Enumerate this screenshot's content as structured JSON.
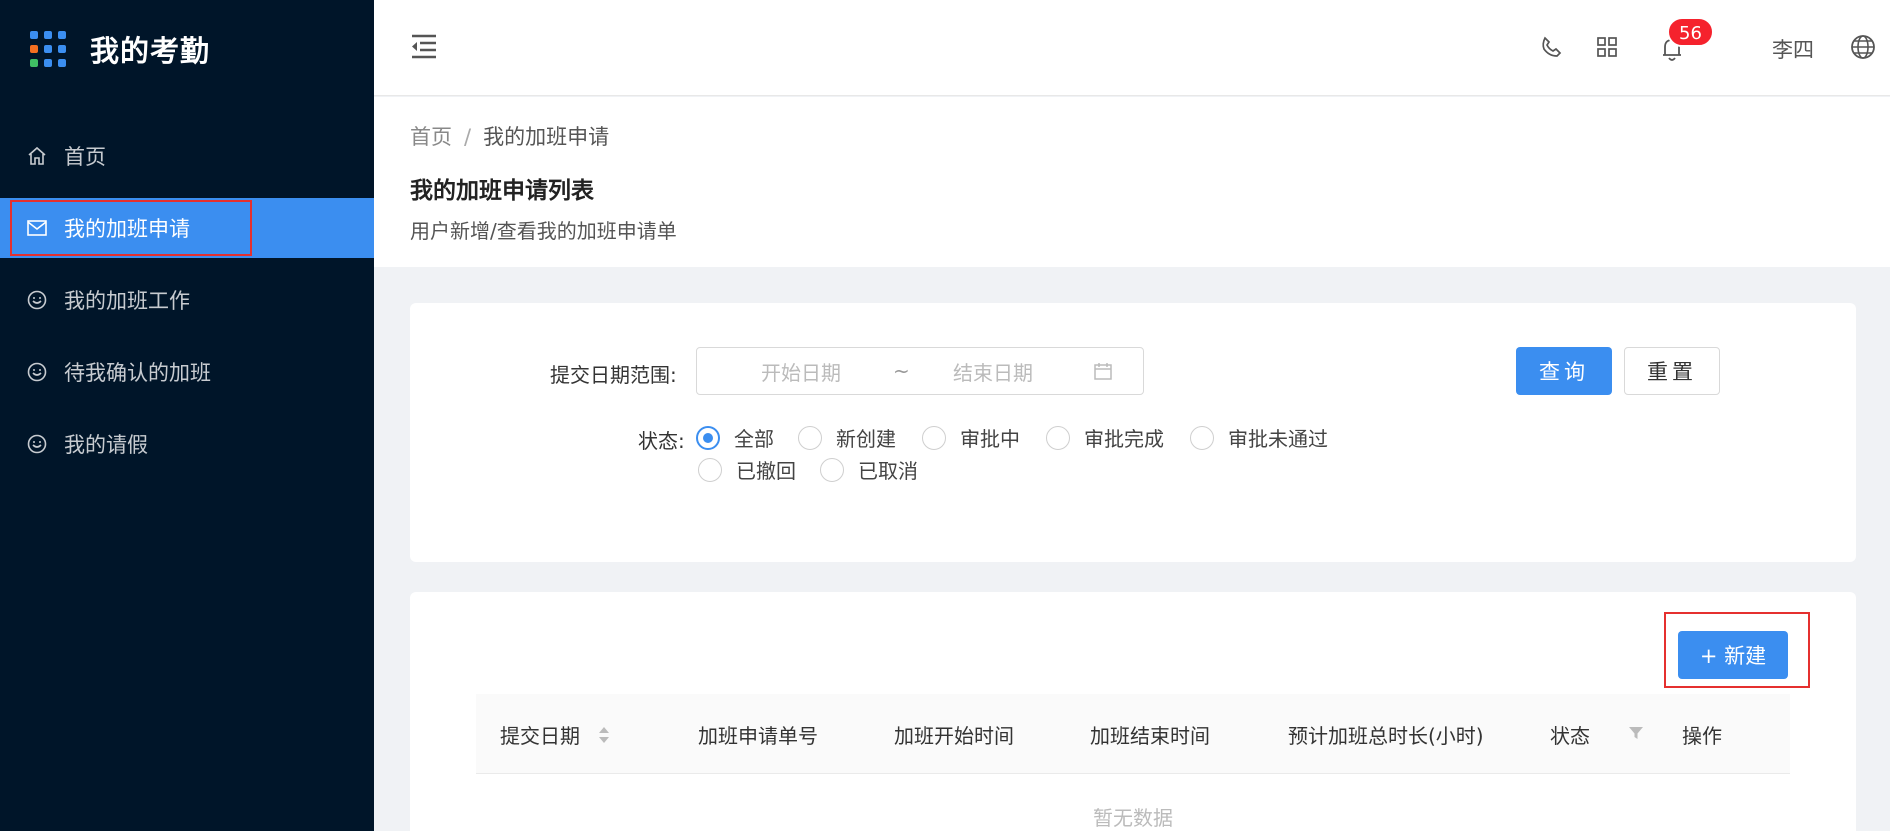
{
  "app": {
    "title": "我的考勤"
  },
  "sidebar": {
    "items": [
      {
        "label": "首页",
        "icon": "home-icon"
      },
      {
        "label": "我的加班申请",
        "icon": "mail-icon",
        "active": true
      },
      {
        "label": "我的加班工作",
        "icon": "smile-icon"
      },
      {
        "label": "待我确认的加班",
        "icon": "smile-icon"
      },
      {
        "label": "我的请假",
        "icon": "smile-icon"
      }
    ]
  },
  "header": {
    "notification_count": "56",
    "user_name": "李四",
    "icons": [
      "menu-fold-icon",
      "phone-icon",
      "apps-icon",
      "bell-icon",
      "globe-icon"
    ]
  },
  "breadcrumb": {
    "home": "首页",
    "separator": "/",
    "current": "我的加班申请"
  },
  "page": {
    "title": "我的加班申请列表",
    "description": "用户新增/查看我的加班申请单"
  },
  "search": {
    "date_label": "提交日期范围:",
    "start_placeholder": "开始日期",
    "range_sep": "~",
    "end_placeholder": "结束日期",
    "query_label": "查询",
    "reset_label": "重置",
    "status_label": "状态:",
    "status_options": [
      "全部",
      "新创建",
      "审批中",
      "审批完成",
      "审批未通过",
      "已撤回",
      "已取消"
    ],
    "status_selected": "全部"
  },
  "table": {
    "new_label": "+ 新建",
    "columns": [
      "提交日期",
      "加班申请单号",
      "加班开始时间",
      "加班结束时间",
      "预计加班总时长(小时)",
      "状态",
      "操作"
    ],
    "empty_text": "暂无数据"
  },
  "colors": {
    "sidebar_bg": "#001529",
    "primary": "#3b8ef0",
    "badge": "#f5222d",
    "highlight": "#e5302f"
  }
}
